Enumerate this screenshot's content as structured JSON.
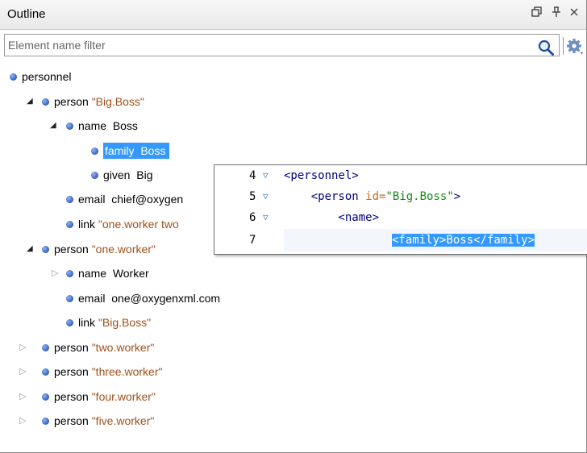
{
  "window": {
    "title": "Outline",
    "restore_icon": "⊡",
    "pin_icon": "⊥",
    "close_icon": "✕"
  },
  "filter": {
    "placeholder": "Element name filter",
    "value": ""
  },
  "tree": {
    "nodes": [
      {
        "name": "personnel",
        "text": ""
      },
      {
        "name": "person",
        "text": "\"Big.Boss\""
      },
      {
        "name": "name",
        "text": "Boss"
      },
      {
        "name": "family",
        "text": "Boss"
      },
      {
        "name": "given",
        "text": "Big"
      },
      {
        "name": "email",
        "text": "chief@oxygen"
      },
      {
        "name": "link",
        "text": "\"one.worker two"
      },
      {
        "name": "person",
        "text": "\"one.worker\""
      },
      {
        "name": "name",
        "text": "Worker"
      },
      {
        "name": "email",
        "text": "one@oxygenxml.com"
      },
      {
        "name": "link",
        "text": "\"Big.Boss\""
      },
      {
        "name": "person",
        "text": "\"two.worker\""
      },
      {
        "name": "person",
        "text": "\"three.worker\""
      },
      {
        "name": "person",
        "text": "\"four.worker\""
      },
      {
        "name": "person",
        "text": "\"five.worker\""
      }
    ]
  },
  "popup": {
    "lines": [
      {
        "num": "4",
        "code": "<personnel>"
      },
      {
        "num": "5",
        "code": "    <person id=\"Big.Boss\">"
      },
      {
        "num": "6",
        "code": "        <name>"
      },
      {
        "num": "7",
        "code": "<family>Boss</family>"
      }
    ],
    "line5_tag": "<person",
    "line5_attr": "id=",
    "line5_val": "\"Big.Boss\"",
    "line5_close": ">"
  },
  "colors": {
    "selection": "#3399ff",
    "attribute_text": "#a0501a",
    "bullet": "#2f5fbf"
  }
}
